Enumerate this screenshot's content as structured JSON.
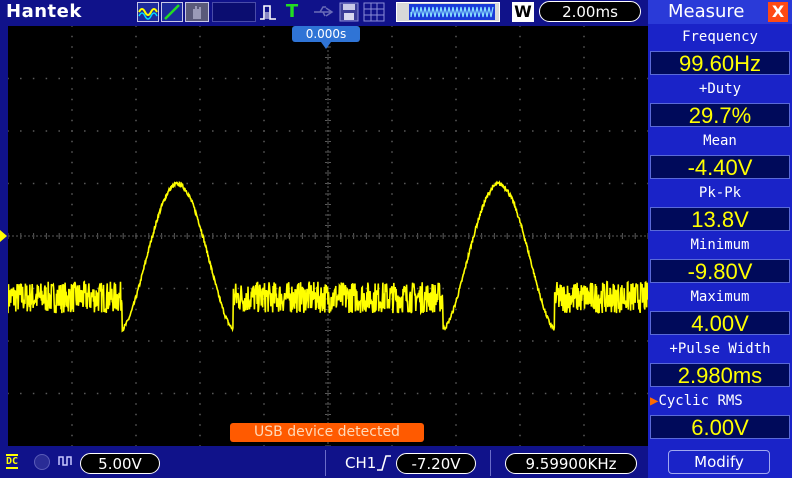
{
  "brand": "Hantek",
  "timebase": "2.00ms",
  "trigger_position": "0.000s",
  "memory_indicator": "W",
  "status_message": "USB device detected",
  "channel": {
    "coupling": "DC",
    "volts_per_div": "5.00V"
  },
  "trigger": {
    "source": "CH1",
    "edge": "rising",
    "level": "-7.20V",
    "frequency": "9.59900KHz"
  },
  "panel": {
    "title": "Measure",
    "close": "X",
    "modify_label": "Modify",
    "measurements": [
      {
        "label": "Frequency",
        "value": "99.60Hz",
        "selected": false
      },
      {
        "label": "+Duty",
        "value": "29.7%",
        "selected": false
      },
      {
        "label": "Mean",
        "value": "-4.40V",
        "selected": false
      },
      {
        "label": "Pk-Pk",
        "value": "13.8V",
        "selected": false
      },
      {
        "label": "Minimum",
        "value": "-9.80V",
        "selected": false
      },
      {
        "label": "Maximum",
        "value": "4.00V",
        "selected": false
      },
      {
        "label": "+Pulse Width",
        "value": "2.980ms",
        "selected": false
      },
      {
        "label": "Cyclic RMS",
        "value": "6.00V",
        "selected": true
      }
    ]
  },
  "colors": {
    "trace": "#ffff00",
    "grid": "#5a5a5a",
    "background": "#10128a",
    "panel": "#1a23c8",
    "warning": "#ff5a00"
  },
  "waveform": {
    "period_ms": 10.04,
    "pulse_width_ms": 2.98,
    "min_v": -9.8,
    "max_v": 4.0,
    "ch1_ground_offset_div": 0.0,
    "noise_v": 1.5,
    "first_peak_center_ms": -4.7
  }
}
